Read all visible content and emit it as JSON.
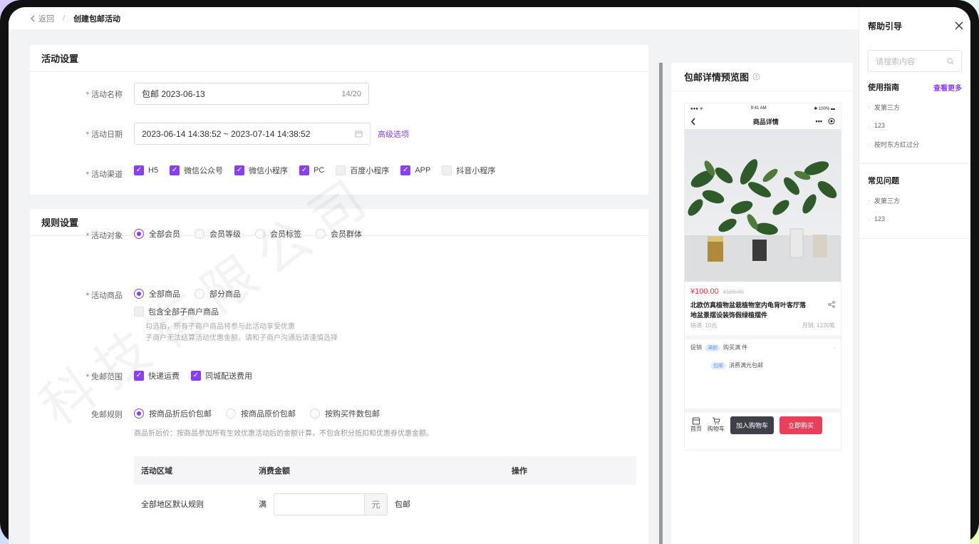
{
  "topbar": {
    "back_label": "返回",
    "separator": "/",
    "page_title": "创建包邮活动"
  },
  "activity_settings": {
    "section_title": "活动设置",
    "name": {
      "label": "活动名称",
      "value": "包邮 2023-06-13",
      "count": "14/20"
    },
    "date": {
      "label": "活动日期",
      "value": "2023-06-14 14:38:52 ~ 2023-07-14 14:38:52",
      "advanced": "高级选项"
    },
    "channels": {
      "label": "活动渠道",
      "items": [
        {
          "label": "H5",
          "checked": true
        },
        {
          "label": "微信公众号",
          "checked": true
        },
        {
          "label": "微信小程序",
          "checked": true
        },
        {
          "label": "PC",
          "checked": true
        },
        {
          "label": "百度小程序",
          "checked": false
        },
        {
          "label": "APP",
          "checked": true
        },
        {
          "label": "抖音小程序",
          "checked": false
        }
      ]
    }
  },
  "rule_settings": {
    "section_title": "规则设置",
    "target": {
      "label": "活动对象",
      "options": [
        "全部会员",
        "会员等级",
        "会员标签",
        "会员群体"
      ],
      "selected": 0
    },
    "goods": {
      "label": "活动商品",
      "options": [
        "全部商品",
        "部分商品"
      ],
      "selected": 0,
      "sub_checkbox": "包含全部子商户商品",
      "hint_1": "勾选后，所有子商户商品将参与此活动享受优惠",
      "hint_2": "子商户无法结算活动优惠金额，请和子商户沟通后请谨慎选择"
    },
    "scope": {
      "label": "免邮范围",
      "items": [
        {
          "label": "快递运费",
          "checked": true
        },
        {
          "label": "同城配送费用",
          "checked": true
        }
      ]
    },
    "rule": {
      "label": "免邮规则",
      "options": [
        "按商品折后价包邮",
        "按商品原价包邮",
        "按购买件数包邮"
      ],
      "selected": 0,
      "hint": "商品折后价：按商品参加所有生效优惠活动后的金额计算，不包含积分抵扣和优惠券优惠金额。"
    },
    "table": {
      "headers": [
        "活动区域",
        "消费金额",
        "操作"
      ],
      "row": {
        "region": "全部地区默认规则",
        "prefix": "满",
        "unit": "元",
        "suffix": "包邮"
      }
    }
  },
  "preview": {
    "title": "包邮详情预览图",
    "status": {
      "signal": "●●● ᯤ",
      "time": "9:41 AM",
      "battery": "✱ 100% ▬"
    },
    "nav_title": "商品详情",
    "price": "¥100.00",
    "original_price": "¥100.00",
    "product_name": "北欧仿真植物盆栽植物室内龟背叶客厅落地盆景摆设装饰假绿植摆件",
    "shipping": "快递: 10元",
    "sales": "月销: 1220笔",
    "promo_label": "促销",
    "promo_tag_1": "满额",
    "promo_text_1": "购买满 件",
    "promo_tag_2": "包邮",
    "promo_text_2": "消费满元包邮",
    "home": "首页",
    "cart": "购物车",
    "add_cart": "加入购物车",
    "buy_now": "立即购买"
  },
  "help": {
    "title": "帮助引导",
    "search_placeholder": "请搜索内容",
    "guide": {
      "title": "使用指南",
      "more": "查看更多",
      "items": [
        "发第三方",
        "123",
        "按时东方红过分"
      ]
    },
    "faq": {
      "title": "常见问题",
      "items": [
        "发第三方",
        "123"
      ]
    }
  },
  "watermark": "科技有限公司",
  "colors": {
    "accent": "#8a3ff5",
    "danger": "#e5363e",
    "buy": "#e8405a"
  }
}
